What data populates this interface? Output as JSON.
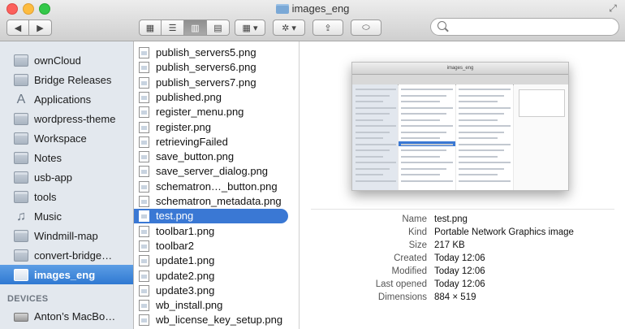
{
  "window": {
    "title": "images_eng"
  },
  "toolbar": {
    "back": "◀",
    "forward": "▶",
    "view_icons": "▦",
    "view_list": "☰",
    "view_columns": "▥",
    "view_coverflow": "▤",
    "arrange": "▦ ▾",
    "action": "✲ ▾",
    "share": "⇪",
    "tags": "⬭",
    "search_placeholder": ""
  },
  "sidebar": {
    "items": [
      {
        "label": "ownCloud",
        "icon": "folder-icon"
      },
      {
        "label": "Bridge Releases",
        "icon": "folder-icon"
      },
      {
        "label": "Applications",
        "icon": "applications-icon"
      },
      {
        "label": "wordpress-theme",
        "icon": "folder-icon"
      },
      {
        "label": "Workspace",
        "icon": "folder-icon"
      },
      {
        "label": "Notes",
        "icon": "folder-icon"
      },
      {
        "label": "usb-app",
        "icon": "folder-icon"
      },
      {
        "label": "tools",
        "icon": "folder-icon"
      },
      {
        "label": "Music",
        "icon": "music-icon"
      },
      {
        "label": "Windmill-map",
        "icon": "folder-icon"
      },
      {
        "label": "convert-bridge…",
        "icon": "folder-icon"
      },
      {
        "label": "images_eng",
        "icon": "folder-icon",
        "selected": true
      }
    ],
    "devices_header": "DEVICES",
    "devices": [
      {
        "label": "Anton’s MacBo…",
        "icon": "drive-icon"
      }
    ]
  },
  "files": [
    {
      "name": "publish_servers5.png"
    },
    {
      "name": "publish_servers6.png"
    },
    {
      "name": "publish_servers7.png"
    },
    {
      "name": "published.png"
    },
    {
      "name": "register_menu.png"
    },
    {
      "name": "register.png"
    },
    {
      "name": "retrievingFailed"
    },
    {
      "name": "save_button.png"
    },
    {
      "name": "save_server_dialog.png"
    },
    {
      "name": "schematron…_button.png"
    },
    {
      "name": "schematron_metadata.png"
    },
    {
      "name": "test.png",
      "selected": true
    },
    {
      "name": "toolbar1.png"
    },
    {
      "name": "toolbar2"
    },
    {
      "name": "update1.png"
    },
    {
      "name": "update2.png"
    },
    {
      "name": "update3.png"
    },
    {
      "name": "wb_install.png"
    },
    {
      "name": "wb_license_key_setup.png"
    }
  ],
  "preview": {
    "thumbnail_title": "images_eng",
    "info": [
      {
        "key": "Name",
        "value": "test.png"
      },
      {
        "key": "Kind",
        "value": "Portable Network Graphics image"
      },
      {
        "key": "Size",
        "value": "217 KB"
      },
      {
        "key": "Created",
        "value": "Today 12:06"
      },
      {
        "key": "Modified",
        "value": "Today 12:06"
      },
      {
        "key": "Last opened",
        "value": "Today 12:06"
      },
      {
        "key": "Dimensions",
        "value": "884 × 519"
      }
    ]
  },
  "colors": {
    "selection": "#3a78d4",
    "sidebar_bg": "#e3e8ee"
  }
}
